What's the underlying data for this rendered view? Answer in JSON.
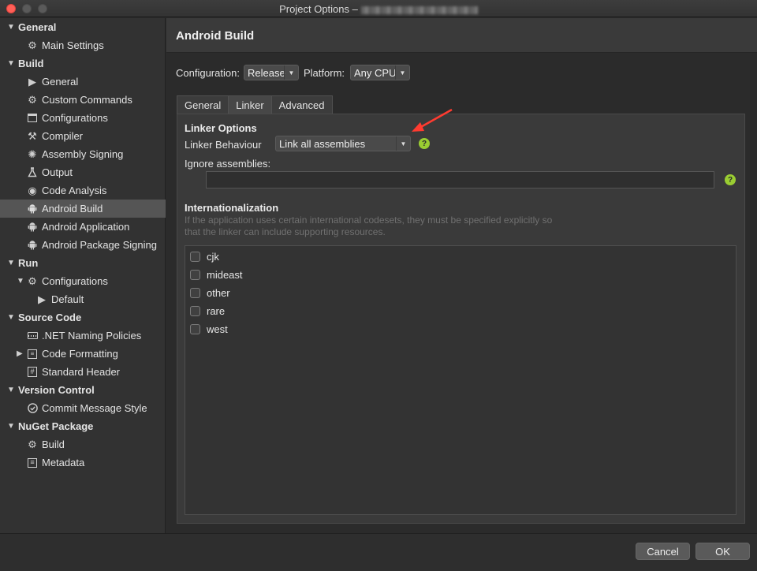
{
  "window": {
    "title": "Project Options –"
  },
  "sidebar": {
    "items": [
      {
        "label": "General",
        "type": "category",
        "icon": ""
      },
      {
        "label": "Main Settings",
        "type": "item",
        "icon": "gear"
      },
      {
        "label": "Build",
        "type": "category",
        "icon": ""
      },
      {
        "label": "General",
        "type": "item",
        "icon": "play"
      },
      {
        "label": "Custom Commands",
        "type": "item",
        "icon": "gear"
      },
      {
        "label": "Configurations",
        "type": "item",
        "icon": "window"
      },
      {
        "label": "Compiler",
        "type": "item",
        "icon": "compiler"
      },
      {
        "label": "Assembly Signing",
        "type": "item",
        "icon": "seal"
      },
      {
        "label": "Output",
        "type": "item",
        "icon": "flask"
      },
      {
        "label": "Code Analysis",
        "type": "item",
        "icon": "target"
      },
      {
        "label": "Android Build",
        "type": "item",
        "icon": "android",
        "selected": true
      },
      {
        "label": "Android Application",
        "type": "item",
        "icon": "android"
      },
      {
        "label": "Android Package Signing",
        "type": "item",
        "icon": "android"
      },
      {
        "label": "Run",
        "type": "category",
        "icon": ""
      },
      {
        "label": "Configurations",
        "type": "item",
        "icon": "gear"
      },
      {
        "label": "Default",
        "type": "subitem",
        "icon": "play"
      },
      {
        "label": "Source Code",
        "type": "category",
        "icon": ""
      },
      {
        "label": ".NET Naming Policies",
        "type": "item",
        "icon": "keyboard"
      },
      {
        "label": "Code Formatting",
        "type": "item",
        "icon": "format"
      },
      {
        "label": "Standard Header",
        "type": "item",
        "icon": "hash"
      },
      {
        "label": "Version Control",
        "type": "category",
        "icon": ""
      },
      {
        "label": "Commit Message Style",
        "type": "item",
        "icon": "check-circle"
      },
      {
        "label": "NuGet Package",
        "type": "category",
        "icon": ""
      },
      {
        "label": "Build",
        "type": "item",
        "icon": "gear"
      },
      {
        "label": "Metadata",
        "type": "item",
        "icon": "list"
      }
    ]
  },
  "main": {
    "title": "Android Build",
    "configuration": {
      "label": "Configuration:",
      "value": "Release"
    },
    "platform": {
      "label": "Platform:",
      "value": "Any CPU"
    },
    "tabs": [
      {
        "label": "General"
      },
      {
        "label": "Linker",
        "active": true
      },
      {
        "label": "Advanced"
      }
    ],
    "linker": {
      "section_title": "Linker Options",
      "behaviour_label": "Linker Behaviour",
      "behaviour_value": "Link all assemblies",
      "ignore_label": "Ignore assemblies:",
      "ignore_value": "",
      "help_glyph": "?"
    },
    "internationalization": {
      "section_title": "Internationalization",
      "description_line1": "If the application uses certain international codesets, they must be specified explicitly so",
      "description_line2": "that the linker can include supporting resources.",
      "codesets": [
        {
          "label": "cjk",
          "checked": false
        },
        {
          "label": "mideast",
          "checked": false
        },
        {
          "label": "other",
          "checked": false
        },
        {
          "label": "rare",
          "checked": false
        },
        {
          "label": "west",
          "checked": false
        }
      ]
    }
  },
  "footer": {
    "cancel_label": "Cancel",
    "ok_label": "OK"
  },
  "colors": {
    "accent_help": "#9acd32",
    "annotation_arrow": "#ff3b30",
    "close_button": "#ff5f57"
  }
}
